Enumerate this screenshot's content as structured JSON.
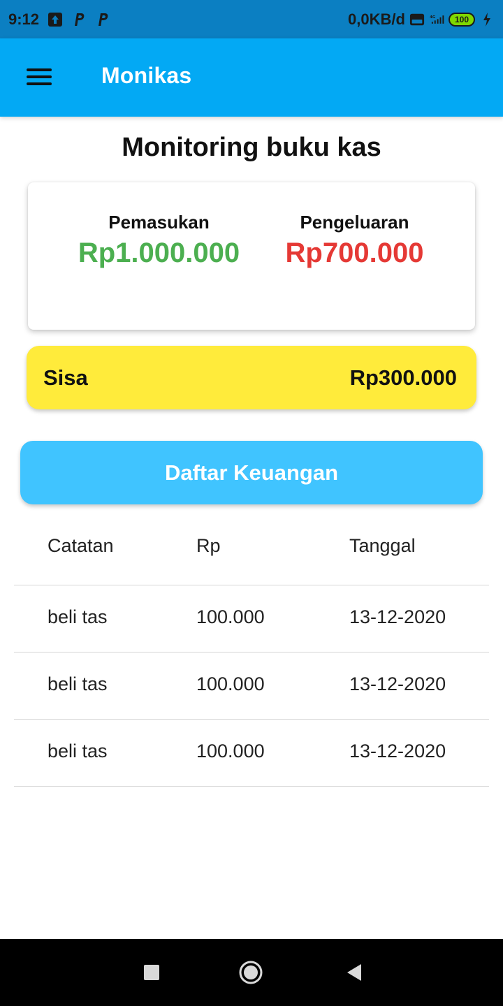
{
  "status_bar": {
    "time": "9:12",
    "network_speed": "0,0KB/d",
    "volte_label": "Vo LTE",
    "network_type": "4G",
    "battery": "100"
  },
  "app_bar": {
    "title": "Monikas",
    "menu_icon": "hamburger-menu-icon"
  },
  "page": {
    "title": "Monitoring buku kas"
  },
  "summary": {
    "income_label": "Pemasukan",
    "income_value": "Rp1.000.000",
    "expense_label": "Pengeluaran",
    "expense_value": "Rp700.000"
  },
  "balance": {
    "label": "Sisa",
    "value": "Rp300.000"
  },
  "list_button": {
    "label": "Daftar Keuangan"
  },
  "table": {
    "columns": [
      "Catatan",
      "Rp",
      "Tanggal"
    ],
    "rows": [
      [
        "beli tas",
        "100.000",
        "13-12-2020"
      ],
      [
        "beli tas",
        "100.000",
        "13-12-2020"
      ],
      [
        "beli tas",
        "100.000",
        "13-12-2020"
      ]
    ]
  },
  "colors": {
    "status_bar": "#0b7fc2",
    "app_bar": "#03a9f4",
    "income": "#4caf50",
    "expense": "#e53935",
    "balance_card": "#ffeb3b",
    "list_button": "#40c4ff"
  },
  "nav_bar": {
    "icons": [
      "recent-apps-icon",
      "home-icon",
      "back-icon"
    ]
  }
}
